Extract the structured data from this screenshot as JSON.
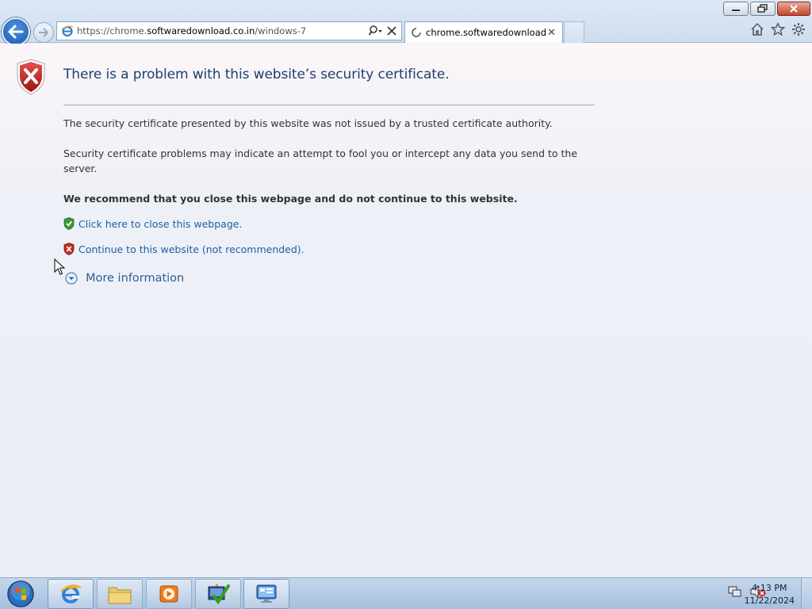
{
  "window": {
    "controls": {
      "minimize": "minimize",
      "restore": "restore",
      "close": "close"
    }
  },
  "browser": {
    "address": {
      "prefix": "https://chrome.",
      "domain": "softwaredownload.co.in",
      "path": "/windows-7"
    },
    "tab": {
      "label": "chrome.softwaredownload..."
    }
  },
  "page": {
    "title": "There is a problem with this website’s security certificate.",
    "paragraph1": "The security certificate presented by this website was not issued by a trusted certificate authority.",
    "paragraph2": "Security certificate problems may indicate an attempt to fool you or intercept any data you send to the server.",
    "recommendation": "We recommend that you close this webpage and do not continue to this website.",
    "close_link": "Click here to close this webpage.",
    "continue_link": "Continue to this website (not recommended).",
    "more_info": "More information"
  },
  "taskbar": {
    "time": "4:13 PM",
    "date": "11/22/2024"
  }
}
